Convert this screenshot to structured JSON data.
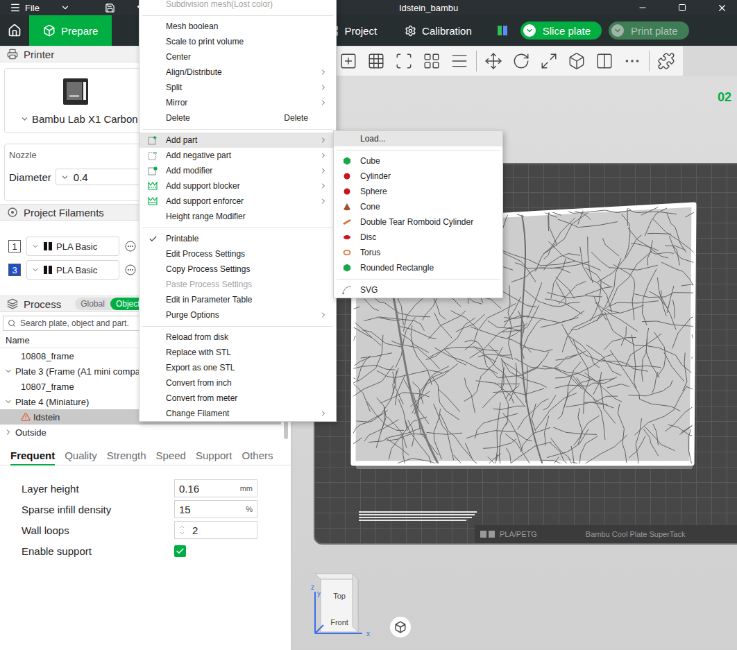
{
  "window": {
    "title": "Idstein_bambu",
    "menu": "File"
  },
  "nav_tabs": [
    {
      "label": "Prepare",
      "selected": true
    },
    {
      "label": "Project",
      "selected": false
    },
    {
      "label": "Calibration",
      "selected": false
    }
  ],
  "actions": [
    {
      "label": "Slice plate",
      "disabled": false
    },
    {
      "label": "Print plate",
      "disabled": true
    }
  ],
  "printer": {
    "title": "Printer",
    "name": "Bambu Lab X1 Carbon",
    "nozzle": "Nozzle",
    "diameter_label": "Diameter",
    "diameter": "0.4"
  },
  "filaments": {
    "title": "Project Filaments",
    "items": [
      {
        "index": "1",
        "name": "PLA Basic",
        "color": "#ffffff"
      },
      {
        "index": "3",
        "name": "PLA Basic",
        "color": "#1f4fc4"
      }
    ]
  },
  "process": {
    "title": "Process",
    "modes": [
      {
        "label": "Global",
        "selected": false
      },
      {
        "label": "Objects",
        "selected": true
      }
    ],
    "search_placeholder": "Search plate, object and part.",
    "column": "Name",
    "rows": [
      {
        "label": "10808_frame",
        "kind": "object",
        "selected": false,
        "warning": false
      },
      {
        "label": "Plate 3 (Frame (A1 mini compa",
        "kind": "plate",
        "expanded": true,
        "selected": false,
        "warning": false
      },
      {
        "label": "10807_frame",
        "kind": "object",
        "selected": false,
        "warning": false
      },
      {
        "label": "Plate 4 (Miniature)",
        "kind": "plate",
        "expanded": true,
        "selected": false,
        "warning": false
      },
      {
        "label": "Idstein",
        "kind": "object",
        "selected": true,
        "warning": true
      },
      {
        "label": "Outside",
        "kind": "plate",
        "expanded": false,
        "selected": false,
        "warning": false
      }
    ]
  },
  "setting_tabs": [
    {
      "label": "Frequent",
      "selected": true
    },
    {
      "label": "Quality",
      "selected": false
    },
    {
      "label": "Strength",
      "selected": false
    },
    {
      "label": "Speed",
      "selected": false
    },
    {
      "label": "Support",
      "selected": false
    },
    {
      "label": "Others",
      "selected": false
    }
  ],
  "settings": [
    {
      "label": "Layer height",
      "kind": "field",
      "value": "0.16",
      "unit": "mm"
    },
    {
      "label": "Sparse infill density",
      "kind": "field",
      "value": "15",
      "unit": "%"
    },
    {
      "label": "Wall loops",
      "kind": "spin",
      "value": "2"
    },
    {
      "label": "Enable support",
      "kind": "checkbox",
      "checked": true
    }
  ],
  "viewport": {
    "plate_number": "02",
    "plate_material": "PLA/PETG",
    "plate_type": "Bambu Cool Plate SuperTack",
    "view_cube": {
      "top": "Top",
      "front": "Front"
    },
    "axes": [
      "x",
      "y",
      "z"
    ]
  },
  "context_menu": {
    "items": [
      {
        "label": "Subdivision mesh(Lost color)",
        "kind": "plain",
        "submenu": false,
        "checked": false,
        "disabled": true,
        "selected": false
      },
      {
        "kind": "separator"
      },
      {
        "label": "Mesh boolean",
        "kind": "plain",
        "submenu": false,
        "checked": false,
        "disabled": false,
        "selected": false
      },
      {
        "label": "Scale to print volume",
        "kind": "plain",
        "submenu": false,
        "checked": false,
        "disabled": false,
        "selected": false
      },
      {
        "label": "Center",
        "kind": "plain",
        "submenu": false,
        "checked": false,
        "disabled": false,
        "selected": false
      },
      {
        "label": "Align/Distribute",
        "kind": "plain",
        "submenu": true,
        "checked": false,
        "disabled": false,
        "selected": false
      },
      {
        "label": "Split",
        "kind": "plain",
        "submenu": true,
        "checked": false,
        "disabled": false,
        "selected": false
      },
      {
        "label": "Mirror",
        "kind": "plain",
        "submenu": true,
        "checked": false,
        "disabled": false,
        "selected": false
      },
      {
        "label": "Delete",
        "kind": "plain",
        "submenu": false,
        "checked": false,
        "disabled": false,
        "selected": false,
        "shortcut": "Delete"
      },
      {
        "kind": "separator"
      },
      {
        "label": "Add part",
        "kind": "part",
        "submenu": true,
        "checked": false,
        "disabled": false,
        "selected": true
      },
      {
        "label": "Add negative part",
        "kind": "negative",
        "submenu": true,
        "checked": false,
        "disabled": false,
        "selected": false
      },
      {
        "label": "Add modifier",
        "kind": "modifier",
        "submenu": true,
        "checked": false,
        "disabled": false,
        "selected": false
      },
      {
        "label": "Add support blocker",
        "kind": "blocker",
        "submenu": true,
        "checked": false,
        "disabled": false,
        "selected": false
      },
      {
        "label": "Add support enforcer",
        "kind": "enforcer",
        "submenu": true,
        "checked": false,
        "disabled": false,
        "selected": false
      },
      {
        "label": "Height range Modifier",
        "kind": "plain",
        "submenu": false,
        "checked": false,
        "disabled": false,
        "selected": false
      },
      {
        "kind": "separator"
      },
      {
        "label": "Printable",
        "kind": "plain",
        "submenu": false,
        "checked": true,
        "disabled": false,
        "selected": false
      },
      {
        "label": "Edit Process Settings",
        "kind": "plain",
        "submenu": false,
        "checked": false,
        "disabled": false,
        "selected": false
      },
      {
        "label": "Copy Process Settings",
        "kind": "plain",
        "submenu": false,
        "checked": false,
        "disabled": false,
        "selected": false
      },
      {
        "label": "Paste Process Settings",
        "kind": "plain",
        "submenu": false,
        "checked": false,
        "disabled": true,
        "selected": false
      },
      {
        "label": "Edit in Parameter Table",
        "kind": "plain",
        "submenu": false,
        "checked": false,
        "disabled": false,
        "selected": false
      },
      {
        "label": "Purge Options",
        "kind": "plain",
        "submenu": true,
        "checked": false,
        "disabled": false,
        "selected": false
      },
      {
        "kind": "separator"
      },
      {
        "label": "Reload from disk",
        "kind": "plain",
        "submenu": false,
        "checked": false,
        "disabled": false,
        "selected": false
      },
      {
        "label": "Replace with STL",
        "kind": "plain",
        "submenu": false,
        "checked": false,
        "disabled": false,
        "selected": false
      },
      {
        "label": "Export as one STL",
        "kind": "plain",
        "submenu": false,
        "checked": false,
        "disabled": false,
        "selected": false
      },
      {
        "label": "Convert from inch",
        "kind": "plain",
        "submenu": false,
        "checked": false,
        "disabled": false,
        "selected": false
      },
      {
        "label": "Convert from meter",
        "kind": "plain",
        "submenu": false,
        "checked": false,
        "disabled": false,
        "selected": false
      },
      {
        "label": "Change Filament",
        "kind": "plain",
        "submenu": true,
        "checked": false,
        "disabled": false,
        "selected": false
      }
    ]
  },
  "submenu": {
    "items": [
      {
        "label": "Load...",
        "kind": "load",
        "selected": true
      },
      {
        "kind": "separator"
      },
      {
        "label": "Cube",
        "kind": "hex",
        "color": "#19a846",
        "selected": false
      },
      {
        "label": "Cylinder",
        "kind": "dot",
        "color": "#c8161d",
        "selected": false
      },
      {
        "label": "Sphere",
        "kind": "dot",
        "color": "#c8161d",
        "selected": false
      },
      {
        "label": "Cone",
        "kind": "cone",
        "color": "#a0522d",
        "selected": false
      },
      {
        "label": "Double Tear Romboid Cylinder",
        "kind": "bar",
        "color": "#e0703c",
        "selected": false
      },
      {
        "label": "Disc",
        "kind": "disc",
        "color": "#c8161d",
        "selected": false
      },
      {
        "label": "Torus",
        "kind": "ring",
        "color": "#d9773a",
        "selected": false
      },
      {
        "label": "Rounded Rectangle",
        "kind": "hex",
        "color": "#19a846",
        "selected": false
      },
      {
        "kind": "separator"
      },
      {
        "label": "SVG",
        "kind": "svg",
        "selected": false
      }
    ]
  }
}
